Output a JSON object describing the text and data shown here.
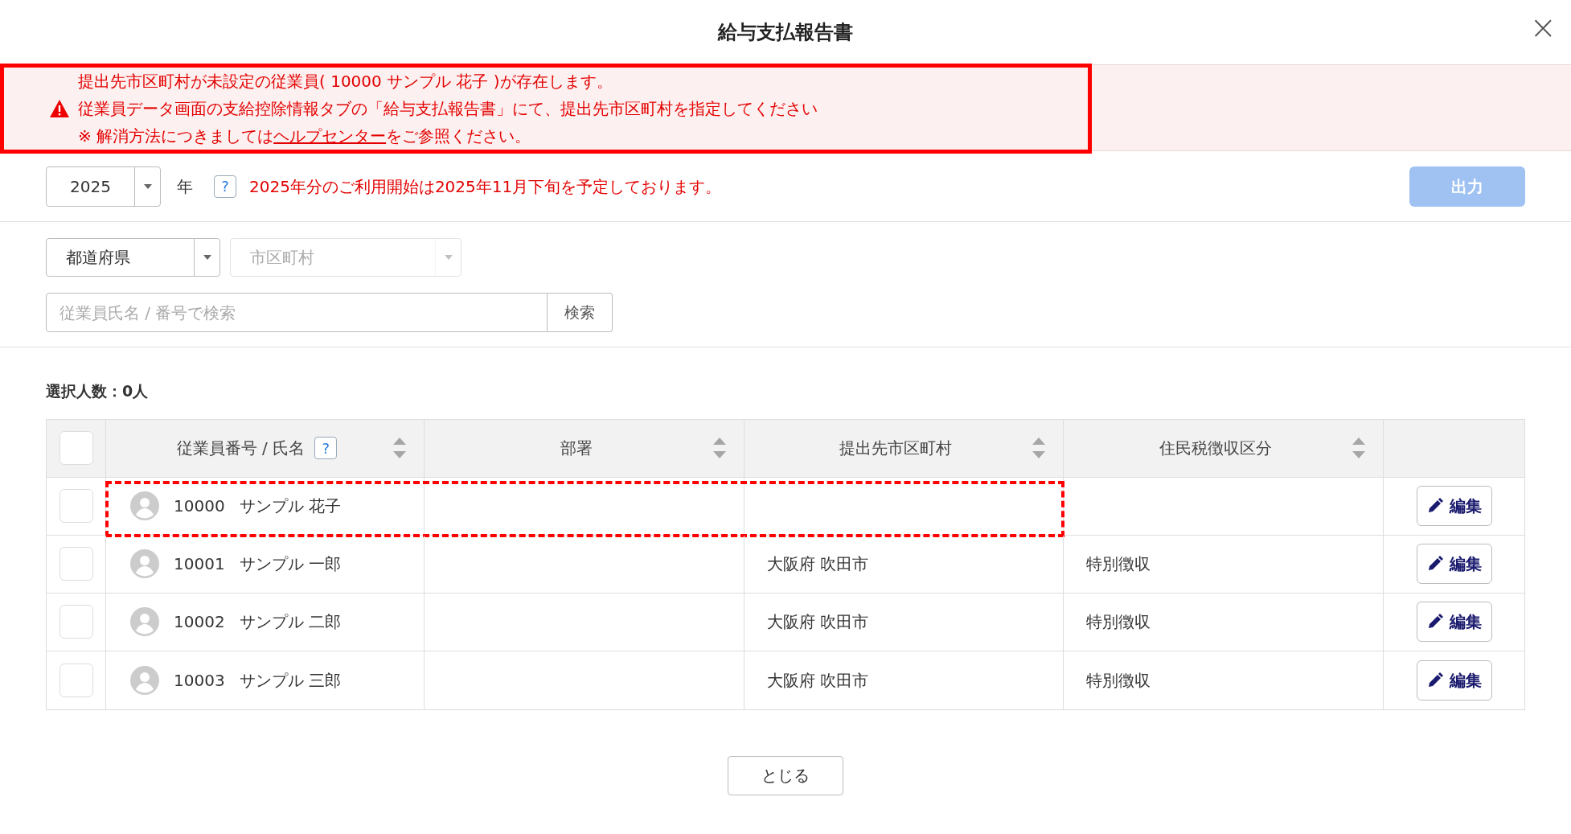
{
  "dialog": {
    "title": "給与支払報告書",
    "close": "×"
  },
  "alert": {
    "outlined": true,
    "lines": [
      "提出先市区町村が未設定の従業員( 10000 サンプル 花子 )が存在します。",
      "従業員データ画面の支給控除情報タブの「給与支払報告書」にて、提出先市区町村を指定してください"
    ],
    "help_before": "※ 解消方法につきましては",
    "help_link": "ヘルプセンター",
    "help_after": "をご参照ください。"
  },
  "year": {
    "value": "2025",
    "unit": "年",
    "help": "?",
    "notice": "2025年分のご利用開始は2025年11月下旬を予定しております。"
  },
  "output_button": {
    "label": "出力",
    "disabled": true
  },
  "prefecture_select": {
    "value": "都道府県",
    "disabled": false
  },
  "city_select": {
    "placeholder": "市区町村",
    "disabled": true
  },
  "search": {
    "placeholder": "従業員氏名 / 番号で検索",
    "button": "検索"
  },
  "selected_count": {
    "label": "選択人数：",
    "value": "0人"
  },
  "table": {
    "select_all_checked": false,
    "columns": [
      {
        "label": "従業員番号 / 氏名",
        "help": "?",
        "sortable": true
      },
      {
        "label": "部署",
        "sortable": true
      },
      {
        "label": "提出先市区町村",
        "sortable": true
      },
      {
        "label": "住民税徴収区分",
        "sortable": true
      }
    ],
    "rows": [
      {
        "checked": false,
        "highlighted": true,
        "number": "10000",
        "name": "サンプル 花子",
        "edit": "編集"
      },
      {
        "checked": false,
        "highlighted": false,
        "number": "10001",
        "name": "サンプル 一郎",
        "city": "大阪府 吹田市",
        "tax": "特別徴収",
        "edit": "編集"
      },
      {
        "checked": false,
        "highlighted": false,
        "number": "10002",
        "name": "サンプル 二郎",
        "city": "大阪府 吹田市",
        "tax": "特別徴収",
        "edit": "編集"
      },
      {
        "checked": false,
        "highlighted": false,
        "number": "10003",
        "name": "サンプル 三郎",
        "city": "大阪府 吹田市",
        "tax": "特別徴収",
        "edit": "編集"
      }
    ]
  },
  "close_button": "とじる"
}
